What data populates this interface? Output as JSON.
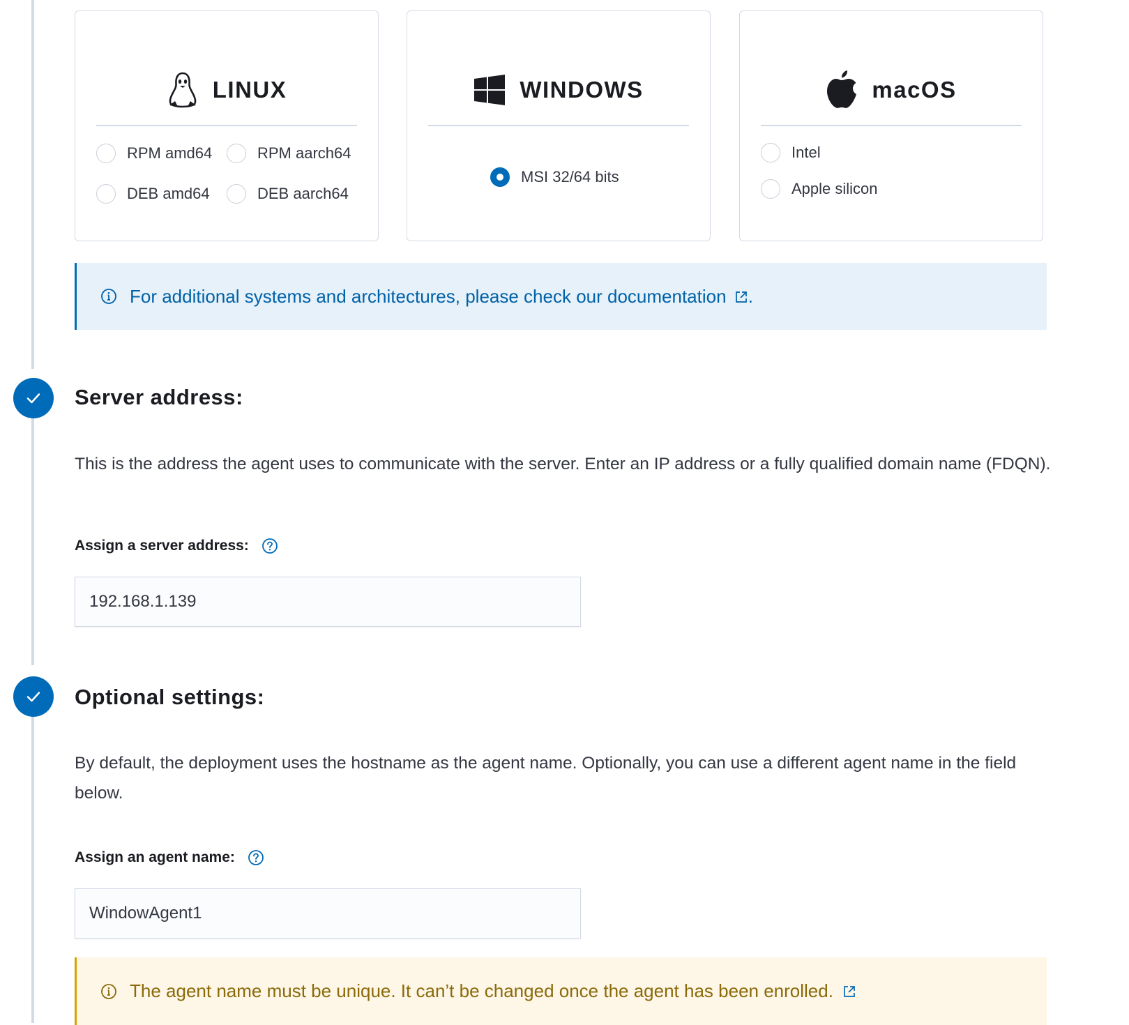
{
  "os_cards": {
    "linux": {
      "title": "LINUX",
      "icon": "penguin-icon",
      "options": [
        {
          "label": "RPM amd64",
          "checked": false
        },
        {
          "label": "RPM aarch64",
          "checked": false
        },
        {
          "label": "DEB amd64",
          "checked": false
        },
        {
          "label": "DEB aarch64",
          "checked": false
        }
      ]
    },
    "windows": {
      "title": "WINDOWS",
      "icon": "windows-logo-icon",
      "options": [
        {
          "label": "MSI 32/64 bits",
          "checked": true
        }
      ]
    },
    "macos": {
      "title": "macOS",
      "icon": "apple-logo-icon",
      "options": [
        {
          "label": "Intel",
          "checked": false
        },
        {
          "label": "Apple silicon",
          "checked": false
        }
      ]
    }
  },
  "info_callout": {
    "text": "For additional systems and architectures, please check our documentation",
    "suffix": "."
  },
  "server_address": {
    "title": "Server address:",
    "description": "This is the address the agent uses to communicate with the server. Enter an IP address or a fully qualified domain name (FDQN).",
    "field_label": "Assign a server address:",
    "value": "192.168.1.139"
  },
  "optional_settings": {
    "title": "Optional settings:",
    "description": "By default, the deployment uses the hostname as the agent name. Optionally, you can use a different agent name in the field below.",
    "field_label": "Assign an agent name:",
    "value": "WindowAgent1"
  },
  "warning_callout": {
    "text": "The agent name must be unique. It can’t be changed once the agent has been enrolled."
  },
  "colors": {
    "primary": "#006bb8",
    "info_bg": "#e6f1fa",
    "warning_bg": "#fef6e6",
    "warning_text": "#8a6a0a",
    "border": "#d3dae6"
  }
}
